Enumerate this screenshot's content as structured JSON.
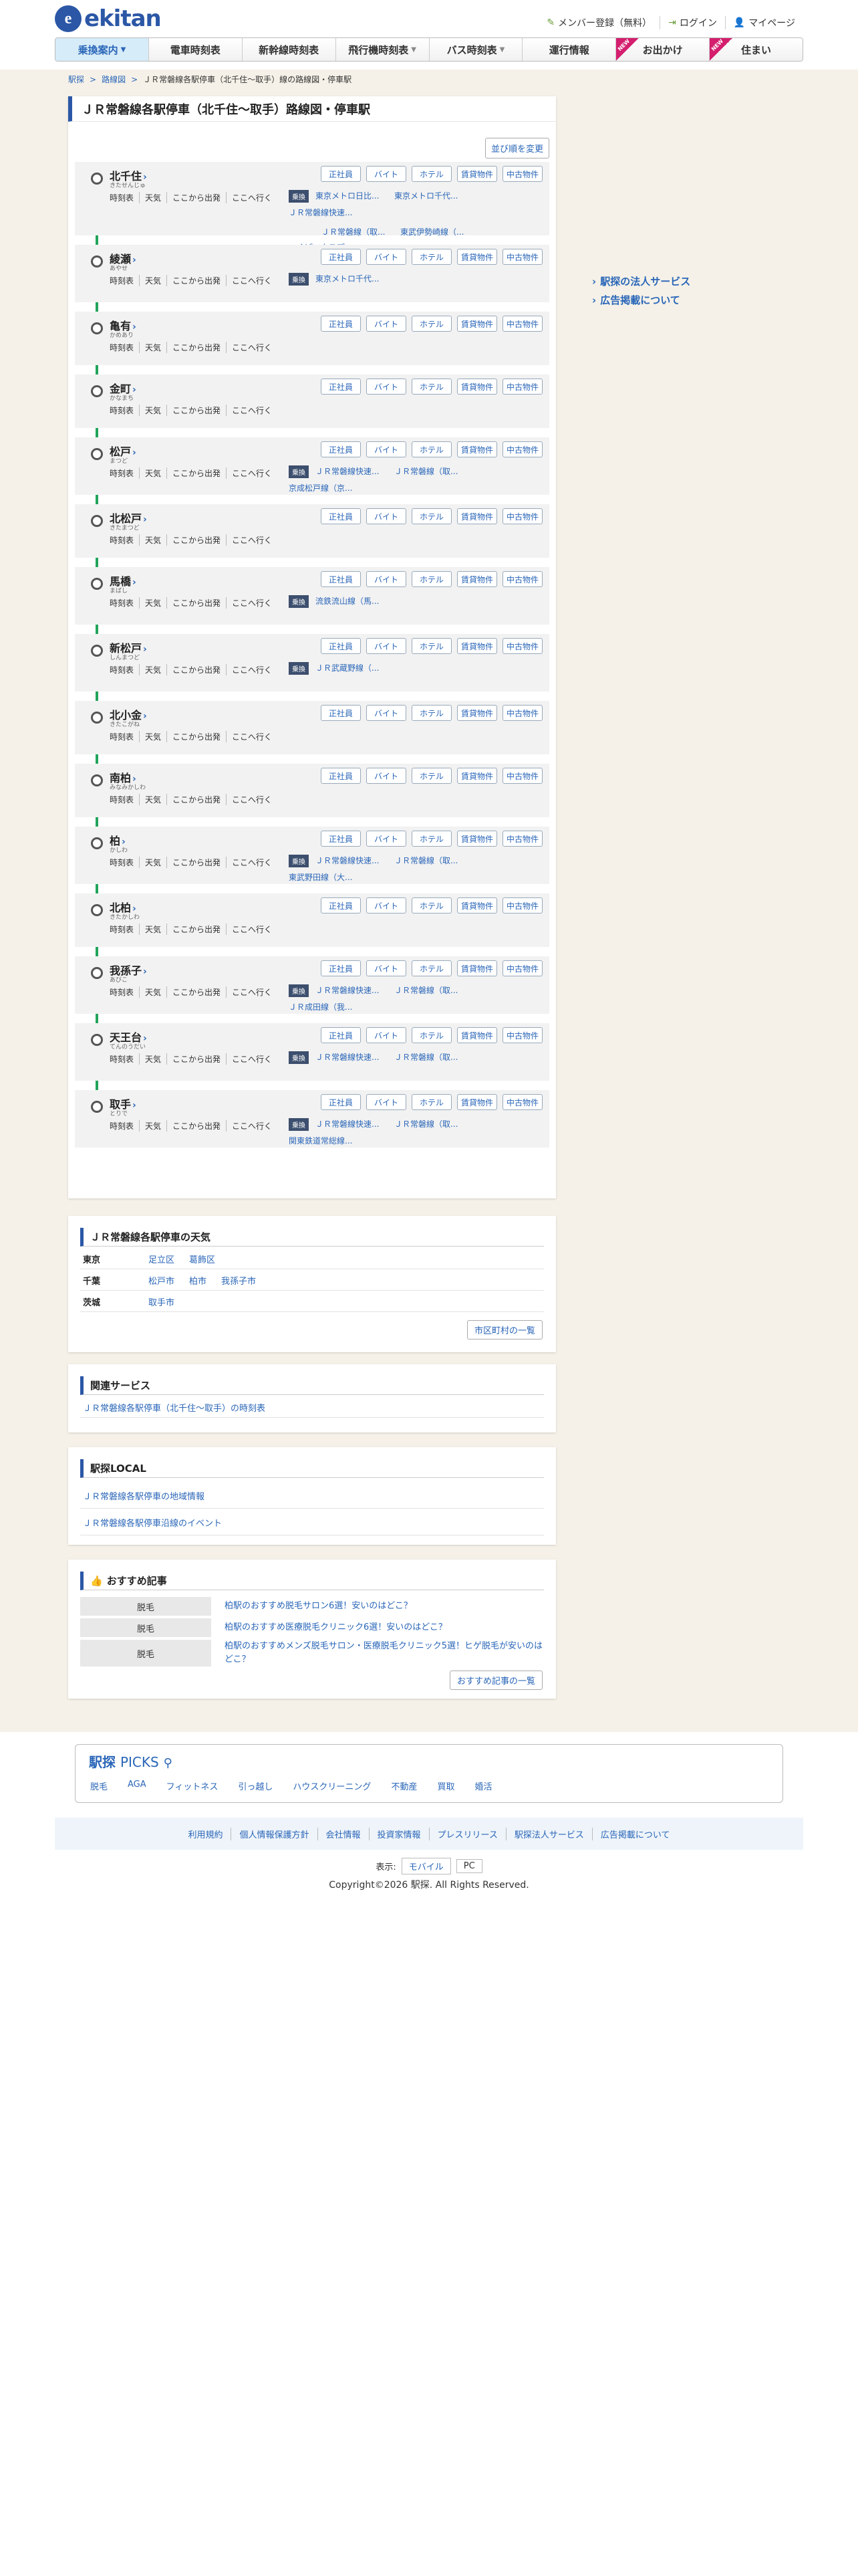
{
  "header": {
    "logo_text": "ekitan",
    "logo_mark": "e",
    "menu": [
      {
        "label": "メンバー登録（無料）",
        "icon": "pencil-icon"
      },
      {
        "label": "ログイン",
        "icon": "login-icon"
      },
      {
        "label": "マイページ",
        "icon": "user-icon"
      }
    ]
  },
  "gnav": [
    {
      "label": "乗換案内",
      "caret": true,
      "active": true
    },
    {
      "label": "電車時刻表"
    },
    {
      "label": "新幹線時刻表"
    },
    {
      "label": "飛行機時刻表",
      "caret": true
    },
    {
      "label": "バス時刻表",
      "caret": true
    },
    {
      "label": "運行情報"
    },
    {
      "label": "お出かけ",
      "new": true
    },
    {
      "label": "住まい",
      "new": true
    }
  ],
  "new_label": "NEW",
  "breadcrumb": [
    "駅探",
    "路線図",
    "ＪＲ常磐線各駅停車（北千住〜取手）線の路線図・停車駅"
  ],
  "page_title": "ＪＲ常磐線各駅停車（北千住〜取手）路線図・停車駅",
  "sort_label": "並び順を変更",
  "station_buttons": [
    "正社員",
    "バイト",
    "ホテル",
    "賃貸物件",
    "中古物件"
  ],
  "station_links": [
    "時刻表",
    "天気",
    "ここから出発",
    "ここへ行く"
  ],
  "transfer_tag": "乗換",
  "stations": [
    {
      "name": "北千住",
      "kana": "きたせんじゅ",
      "lines": [
        "東京メトロ日比...",
        "東京メトロ千代...",
        "ＪＲ常磐線快速...",
        "ＪＲ常磐線（取...",
        "東武伊勢崎線（...",
        "つくばエクスプ..."
      ]
    },
    {
      "name": "綾瀬",
      "kana": "あやせ",
      "lines": [
        "東京メトロ千代..."
      ]
    },
    {
      "name": "亀有",
      "kana": "かめあり",
      "lines": []
    },
    {
      "name": "金町",
      "kana": "かなまち",
      "lines": []
    },
    {
      "name": "松戸",
      "kana": "まつど",
      "lines": [
        "ＪＲ常磐線快速...",
        "ＪＲ常磐線（取...",
        "京成松戸線（京..."
      ]
    },
    {
      "name": "北松戸",
      "kana": "きたまつど",
      "lines": []
    },
    {
      "name": "馬橋",
      "kana": "まばし",
      "lines": [
        "流鉄流山線（馬..."
      ]
    },
    {
      "name": "新松戸",
      "kana": "しんまつど",
      "lines": [
        "ＪＲ武蔵野線（..."
      ]
    },
    {
      "name": "北小金",
      "kana": "きたこがね",
      "lines": []
    },
    {
      "name": "南柏",
      "kana": "みなみかしわ",
      "lines": []
    },
    {
      "name": "柏",
      "kana": "かしわ",
      "lines": [
        "ＪＲ常磐線快速...",
        "ＪＲ常磐線（取...",
        "東武野田線（大..."
      ]
    },
    {
      "name": "北柏",
      "kana": "きたかしわ",
      "lines": []
    },
    {
      "name": "我孫子",
      "kana": "あびこ",
      "lines": [
        "ＪＲ常磐線快速...",
        "ＪＲ常磐線（取...",
        "ＪＲ成田線（我..."
      ]
    },
    {
      "name": "天王台",
      "kana": "てんのうだい",
      "lines": [
        "ＪＲ常磐線快速...",
        "ＪＲ常磐線（取..."
      ]
    },
    {
      "name": "取手",
      "kana": "とりで",
      "lines": [
        "ＪＲ常磐線快速...",
        "ＪＲ常磐線（取...",
        "関東鉄道常総線..."
      ]
    }
  ],
  "sidebar": [
    "駅探の法人サービス",
    "広告掲載について"
  ],
  "weather": {
    "title": "ＪＲ常磐線各駅停車の天気",
    "rows": [
      {
        "pref": "東京",
        "cities": [
          "足立区",
          "葛飾区"
        ]
      },
      {
        "pref": "千葉",
        "cities": [
          "松戸市",
          "柏市",
          "我孫子市"
        ]
      },
      {
        "pref": "茨城",
        "cities": [
          "取手市"
        ]
      }
    ],
    "more": "市区町村の一覧"
  },
  "related": {
    "title": "関連サービス",
    "items": [
      "ＪＲ常磐線各駅停車（北千住〜取手）の時刻表"
    ]
  },
  "local": {
    "title": "駅探LOCAL",
    "items": [
      "ＪＲ常磐線各駅停車の地域情報",
      "ＪＲ常磐線各駅停車沿線のイベント"
    ]
  },
  "articles": {
    "title": "おすすめ記事",
    "items": [
      {
        "cat": "脱毛",
        "title": "柏駅のおすすめ脱毛サロン6選！安いのはどこ？"
      },
      {
        "cat": "脱毛",
        "title": "柏駅のおすすめ医療脱毛クリニック6選！安いのはどこ？"
      },
      {
        "cat": "脱毛",
        "title": "柏駅のおすすめメンズ脱毛サロン・医療脱毛クリニック5選！ヒゲ脱毛が安いのはどこ？"
      }
    ],
    "more": "おすすめ記事の一覧"
  },
  "picks": {
    "title": "駅探",
    "title2": "PICKS",
    "items": [
      "脱毛",
      "AGA",
      "フィットネス",
      "引っ越し",
      "ハウスクリーニング",
      "不動産",
      "買取",
      "婚活"
    ]
  },
  "footer_links": [
    "利用規約",
    "個人情報保護方針",
    "会社情報",
    "投資家情報",
    "プレスリリース",
    "駅探法人サービス",
    "広告掲載について"
  ],
  "display": {
    "label": "表示:",
    "options": [
      "モバイル",
      "PC"
    ]
  },
  "copyright": "Copyright©2026 駅探. All Rights Reserved."
}
